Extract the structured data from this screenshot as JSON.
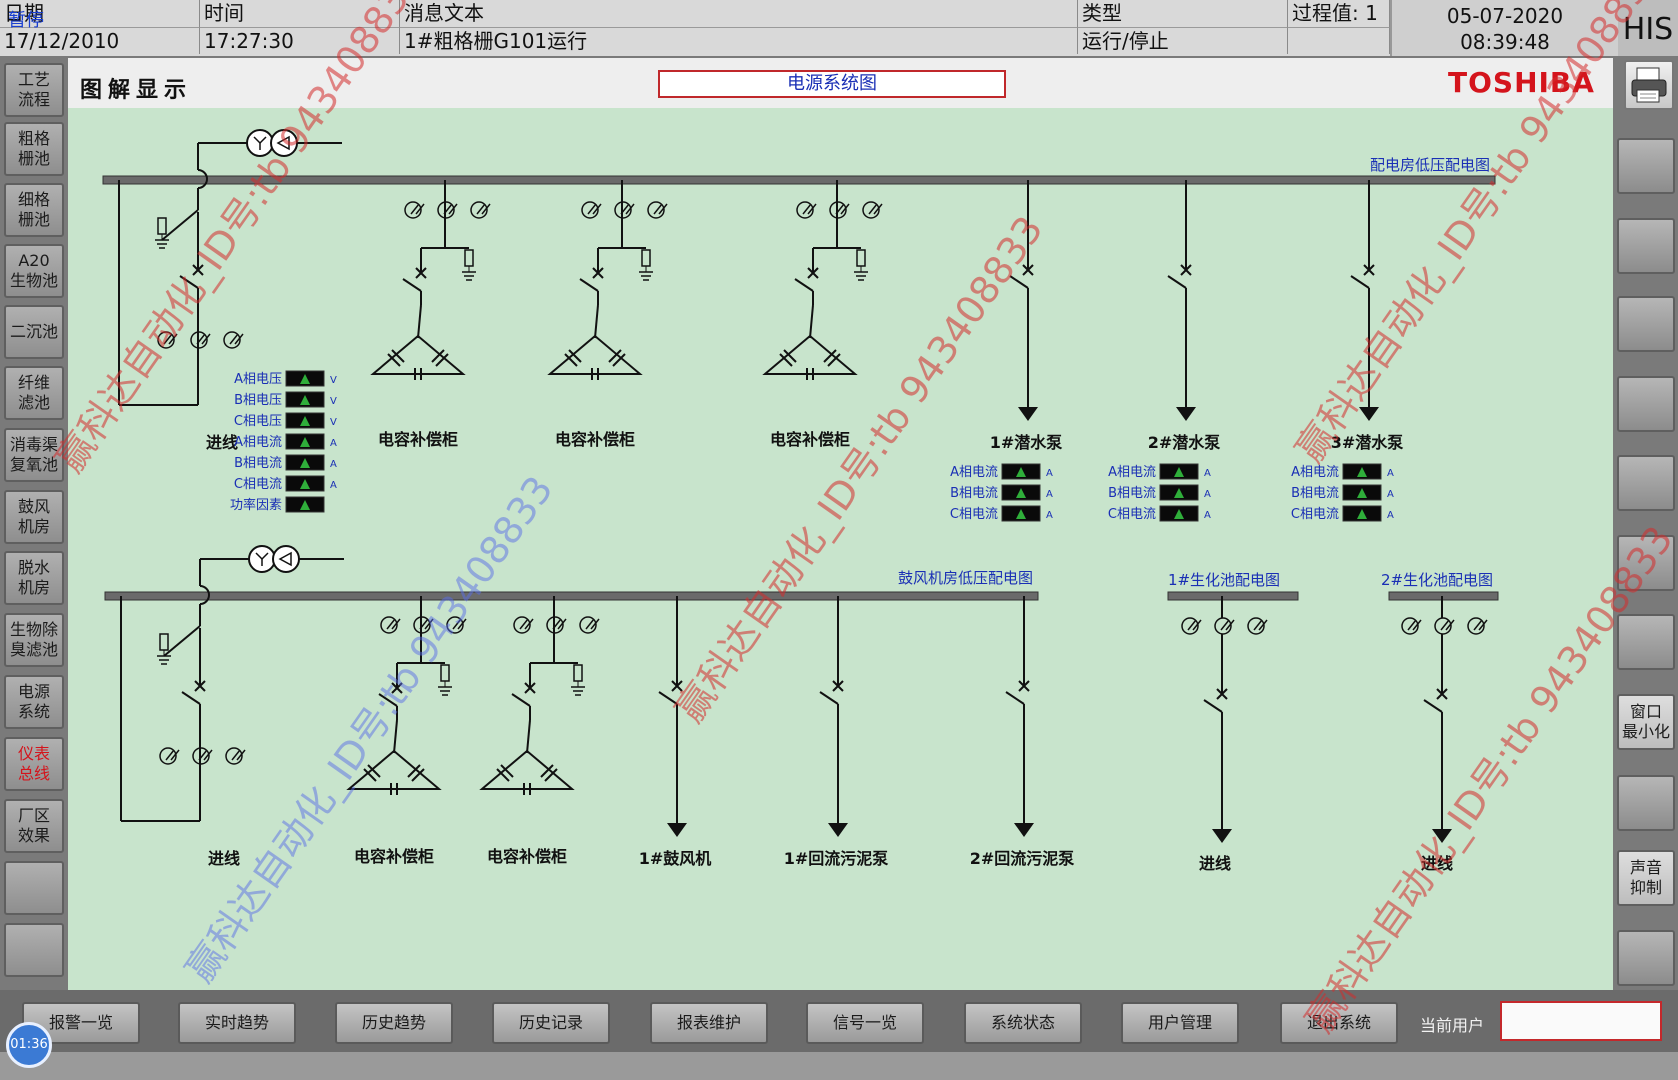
{
  "alarm_bar": {
    "pause_label": "暂停",
    "headers": {
      "date": "日期",
      "time": "时间",
      "message": "消息文本",
      "type": "类型",
      "process_value": "过程值: 1"
    },
    "row": {
      "date": "17/12/2010",
      "time": "17:27:30",
      "message": "1#粗格栅G101运行",
      "type": "运行/停止",
      "process_value": ""
    }
  },
  "clock": {
    "date": "05-07-2020",
    "time": "08:39:48"
  },
  "his_label": "HIS",
  "header": {
    "page_title": "图解显示",
    "diagram_title": "电源系统图",
    "brand": "TOSHIBA"
  },
  "left_nav": [
    {
      "label": "工艺\n流程",
      "highlight": false
    },
    {
      "label": "粗格\n栅池",
      "highlight": false
    },
    {
      "label": "细格\n栅池",
      "highlight": false
    },
    {
      "label": "A20\n生物池",
      "highlight": false
    },
    {
      "label": "二沉池",
      "highlight": false
    },
    {
      "label": "纤维\n滤池",
      "highlight": false
    },
    {
      "label": "消毒渠\n复氧池",
      "highlight": false
    },
    {
      "label": "鼓风\n机房",
      "highlight": false
    },
    {
      "label": "脱水\n机房",
      "highlight": false
    },
    {
      "label": "生物除\n臭滤池",
      "highlight": false
    },
    {
      "label": "电源\n系统",
      "highlight": false
    },
    {
      "label": "仪表\n总线",
      "highlight": true
    },
    {
      "label": "厂区\n效果",
      "highlight": false
    },
    {
      "label": "",
      "highlight": false
    },
    {
      "label": "",
      "highlight": false
    }
  ],
  "right_panel": {
    "minimize_label": "窗口\n最小化",
    "mute_label": "声音\n抑制"
  },
  "diagram": {
    "top_bus_label": "配电房低压配电图",
    "bottom_bus_label": "鼓风机房低压配电图",
    "bio1_label": "1#生化池配电图",
    "bio2_label": "2#生化池配电图",
    "incoming_label": "进线",
    "capacitor_label": "电容补偿柜",
    "pumps": [
      "1#潜水泵",
      "2#潜水泵",
      "3#潜水泵"
    ],
    "blower": "1#鼓风机",
    "sludge": [
      "1#回流污泥泵",
      "2#回流污泥泵"
    ],
    "incoming_meters": [
      {
        "label": "A相电压",
        "unit": "V"
      },
      {
        "label": "B相电压",
        "unit": "V"
      },
      {
        "label": "C相电压",
        "unit": "V"
      },
      {
        "label": "A相电流",
        "unit": "A"
      },
      {
        "label": "B相电流",
        "unit": "A"
      },
      {
        "label": "C相电流",
        "unit": "A"
      },
      {
        "label": "功率因素",
        "unit": ""
      }
    ],
    "pump_meters": [
      {
        "label": "A相电流",
        "unit": "A"
      },
      {
        "label": "B相电流",
        "unit": "A"
      },
      {
        "label": "C相电流",
        "unit": "A"
      }
    ]
  },
  "bottom_buttons": [
    "报警一览",
    "实时趋势",
    "历史趋势",
    "历史记录",
    "报表维护",
    "信号一览",
    "系统状态",
    "用户管理",
    "退出系统"
  ],
  "current_user_label": "当前用户",
  "current_user_value": "",
  "timer": "01:36",
  "watermarks": [
    {
      "text": "赢科达自动化_ID号:tb 943408833",
      "color": "red"
    },
    {
      "text": "赢科达自动化_ID号:tb 943408833",
      "color": "red"
    },
    {
      "text": "赢科达自动化_ID号:tb 943408833",
      "color": "red"
    },
    {
      "text": "赢科达自动化_ID号:tb 943408833",
      "color": "blue"
    },
    {
      "text": "赢科达自动化_ID号:tb 943408833",
      "color": "red"
    }
  ],
  "colors": {
    "canvas": "#c8e4cc",
    "diagram_text": "#1a2fb5",
    "brand": "#d4141c",
    "alarm_text": "#d4141c"
  }
}
